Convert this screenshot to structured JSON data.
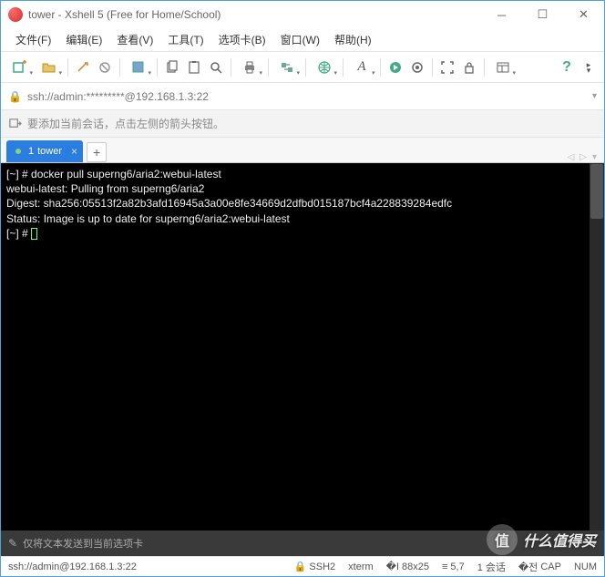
{
  "titlebar": {
    "title": "tower - Xshell 5 (Free for Home/School)"
  },
  "menu": {
    "file": "文件(F)",
    "edit": "编辑(E)",
    "view": "查看(V)",
    "tools": "工具(T)",
    "tabs": "选项卡(B)",
    "window": "窗口(W)",
    "help": "帮助(H)"
  },
  "address": {
    "text": "ssh://admin:*********@192.168.1.3:22"
  },
  "hint": {
    "text": "要添加当前会话，点击左侧的箭头按钮。"
  },
  "tabs": {
    "active": {
      "index": "1",
      "label": "tower"
    }
  },
  "terminal": {
    "lines": [
      "[~] # docker pull superng6/aria2:webui-latest",
      "webui-latest: Pulling from superng6/aria2",
      "Digest: sha256:05513f2a82b3afd16945a3a00e8fe34669d2dfbd015187bcf4a228839284edfc",
      "Status: Image is up to date for superng6/aria2:webui-latest",
      "[~] # "
    ]
  },
  "sendbar": {
    "text": "仅将文本发送到当前选项卡"
  },
  "status": {
    "conn": "ssh://admin@192.168.1.3:22",
    "proto": "SSH2",
    "term": "xterm",
    "size": "88x25",
    "pos": "5,7",
    "session": "1 会话",
    "caps": "CAP",
    "num": "NUM"
  },
  "watermark": {
    "text": "什么值得买"
  }
}
